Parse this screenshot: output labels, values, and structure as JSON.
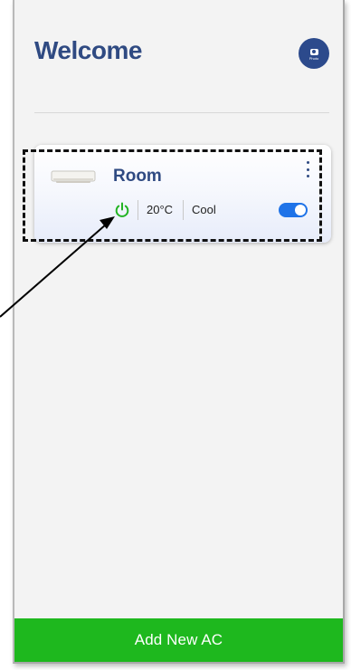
{
  "header": {
    "title": "Welcome",
    "photo_button_label": "Photo"
  },
  "ac_cards": [
    {
      "name": "Room",
      "temperature": "20°C",
      "mode": "Cool",
      "power_on": true,
      "toggle_on": true
    }
  ],
  "footer": {
    "add_button_label": "Add New AC"
  },
  "icons": {
    "power": "power-icon",
    "menu": "more-vertical-icon",
    "camera": "camera-icon",
    "ac_unit": "air-conditioner-icon"
  },
  "colors": {
    "title": "#2f4a82",
    "photo_button": "#2c4a8c",
    "power_on": "#22b322",
    "toggle_on": "#1f73e8",
    "add_button": "#1eb81e"
  }
}
